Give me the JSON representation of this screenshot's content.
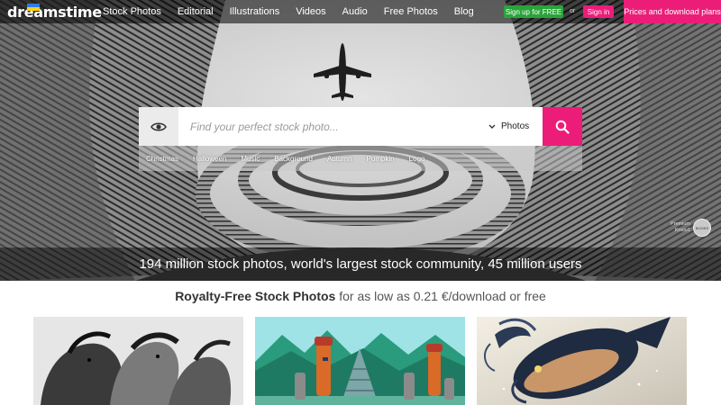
{
  "brand": {
    "logo_text": "dreamstime"
  },
  "nav": {
    "links": [
      "Stock Photos",
      "Editorial",
      "Illustrations",
      "Videos",
      "Audio",
      "Free Photos",
      "Blog"
    ],
    "signup_label": "Sign up for FREE",
    "or_label": "or",
    "signin_label": "Sign in",
    "prices_label": "Prices and download plans"
  },
  "search": {
    "placeholder": "Find your perfect stock photo...",
    "type_selected": "Photos",
    "tags": [
      "Christmas",
      "Halloween",
      "Music",
      "Background",
      "Autumn",
      "Pumpkin",
      "Logo"
    ]
  },
  "hero": {
    "credit_line1": "Premium",
    "credit_line2": "Kristo1",
    "credit_badge": "BOOKS",
    "stats_text": "194 million stock photos, world's largest stock community, 45 million users"
  },
  "headline": {
    "bold": "Royalty-Free Stock Photos",
    "rest": " for as low as 0.21 €/download or free"
  },
  "thumbnails": [
    {
      "name": "horses"
    },
    {
      "name": "moai-pyramid"
    },
    {
      "name": "fish-fantasy"
    }
  ],
  "colors": {
    "accent_pink": "#ec1d79",
    "signup_green": "#2aa43a"
  }
}
